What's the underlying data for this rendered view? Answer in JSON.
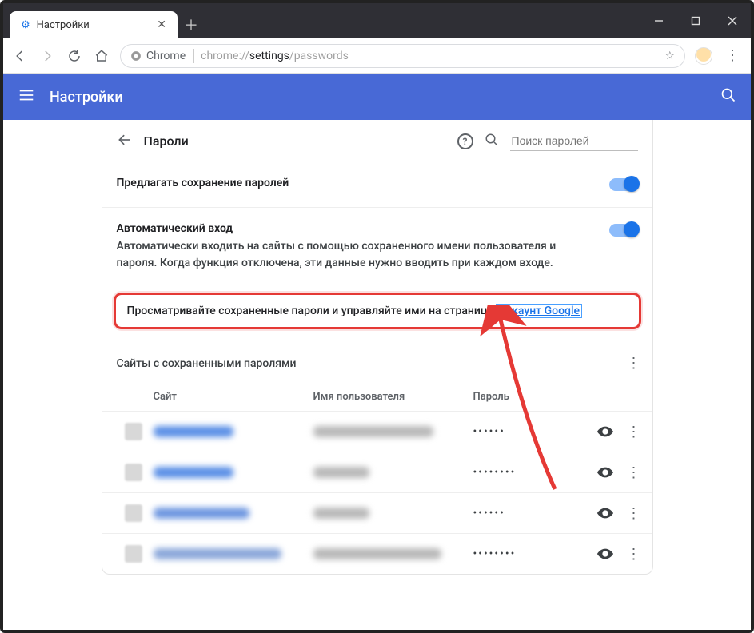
{
  "window": {
    "tab_title": "Настройки",
    "site_chip": "Chrome",
    "url_prefix": "chrome://",
    "url_host": "settings",
    "url_path": "/passwords"
  },
  "header": {
    "title": "Настройки"
  },
  "page": {
    "title": "Пароли",
    "search_placeholder": "Поиск паролей",
    "offer_save": "Предлагать сохранение паролей",
    "auto_signin_title": "Автоматический вход",
    "auto_signin_desc": "Автоматически входить на сайты с помощью сохраненного имени пользователя и пароля. Когда функция отключена, эти данные нужно вводить при каждом входе.",
    "manage_text": "Просматривайте сохраненные пароли и управляйте ими на странице ",
    "manage_link": "Аккаунт Google",
    "saved_sites_label": "Сайты с сохраненными паролями",
    "cols": {
      "site": "Сайт",
      "user": "Имя пользователя",
      "pass": "Пароль"
    },
    "rows": [
      {
        "pass": "••••••"
      },
      {
        "pass": "••••••••"
      },
      {
        "pass": "••••••"
      },
      {
        "pass": "••••••••"
      }
    ]
  }
}
